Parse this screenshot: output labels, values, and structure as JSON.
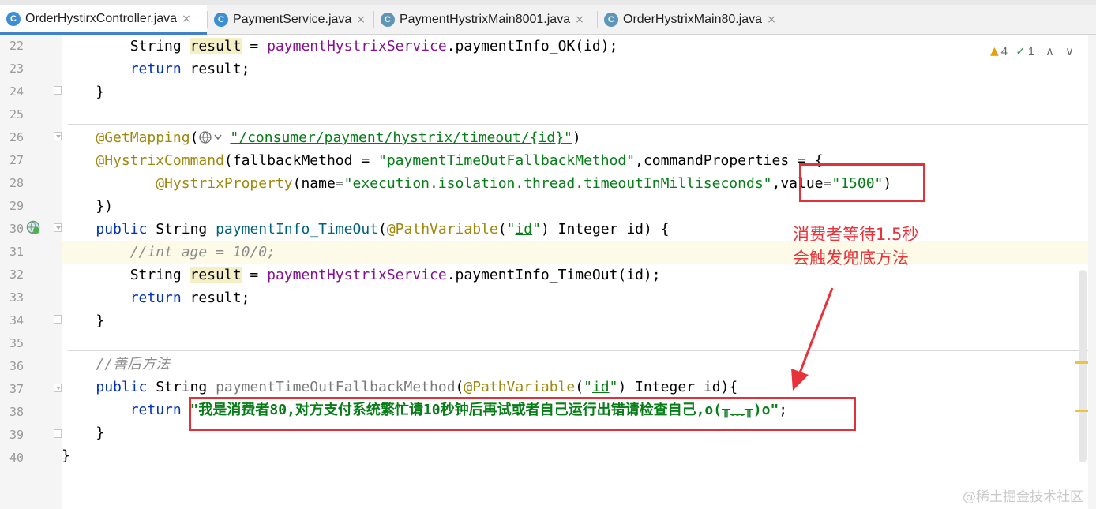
{
  "tabs": [
    {
      "label": "OrderHystirxController.java",
      "icon": "class-icon",
      "active": true
    },
    {
      "label": "PaymentService.java",
      "icon": "class-icon",
      "active": false
    },
    {
      "label": "PaymentHystrixMain8001.java",
      "icon": "spring-boot-app-icon",
      "active": false
    },
    {
      "label": "OrderHystrixMain80.java",
      "icon": "spring-boot-app-icon",
      "active": false
    }
  ],
  "tab_close": "×",
  "inspections": {
    "warnings": "4",
    "weak_warnings": "1",
    "up": "∧",
    "down": "∨"
  },
  "line_numbers": [
    "22",
    "23",
    "24",
    "25",
    "26",
    "27",
    "28",
    "29",
    "30",
    "31",
    "32",
    "33",
    "34",
    "35",
    "36",
    "37",
    "38",
    "39",
    "40"
  ],
  "code": {
    "l22": {
      "t1": "String ",
      "t2": "result",
      "t3": " = ",
      "t4": "paymentHystrixService",
      "t5": ".paymentInfo_OK(id);"
    },
    "l23": {
      "t1": "return",
      "t2": " result;"
    },
    "l24": {
      "t1": "}"
    },
    "l26": {
      "t1": "@GetMapping",
      "t2": "(",
      "t3": "\"/consumer/payment/hystrix/timeout/{id}\"",
      "t4": ")"
    },
    "l27": {
      "t1": "@HystrixCommand",
      "t2": "(fallbackMethod = ",
      "t3": "\"paymentTimeOutFallbackMethod\"",
      "t4": ",commandProperties = {"
    },
    "l28": {
      "t1": "@HystrixProperty",
      "t2": "(name=",
      "t3": "\"execution.isolation.thread.timeoutInMilliseconds\"",
      "t4": ",value=",
      "t5": "\"1500\"",
      "t6": ")"
    },
    "l29": {
      "t1": "})"
    },
    "l30": {
      "t1": "public",
      "t2": " String ",
      "t3": "paymentInfo_TimeOut",
      "t4": "(",
      "t5": "@PathVariable",
      "t6": "(",
      "t7": "\"",
      "t8": "id",
      "t9": "\"",
      "t10": ") Integer id) {"
    },
    "l31": {
      "t1": "//int age = 10/0;"
    },
    "l32": {
      "t1": "String ",
      "t2": "result",
      "t3": " = ",
      "t4": "paymentHystrixService",
      "t5": ".paymentInfo_TimeOut(id);"
    },
    "l33": {
      "t1": "return",
      "t2": " result;"
    },
    "l34": {
      "t1": "}"
    },
    "l36": {
      "t1": "//善后方法"
    },
    "l37": {
      "t1": "public",
      "t2": " String ",
      "t3": "paymentTimeOutFallbackMethod",
      "t4": "(",
      "t5": "@PathVariable",
      "t6": "(",
      "t7": "\"",
      "t8": "id",
      "t9": "\"",
      "t10": ") Integer id){"
    },
    "l38": {
      "t1": "return",
      "t2": " ",
      "t3": "\"我是消费者80,对方支付系统繁忙请10秒钟后再试或者自己运行出错请检查自己,o(╥﹏╥)o\"",
      "t4": ";"
    },
    "l39": {
      "t1": "}"
    },
    "l40": {
      "t1": "}"
    }
  },
  "annotation_note": {
    "line1": "消费者等待1.5秒",
    "line2": "会触发兜底方法"
  },
  "watermark": "@稀土掘金技术社区",
  "colors": {
    "accent_red": "#e0323a",
    "keyword": "#0033b3",
    "string": "#067d17",
    "annotation": "#9e880d"
  }
}
